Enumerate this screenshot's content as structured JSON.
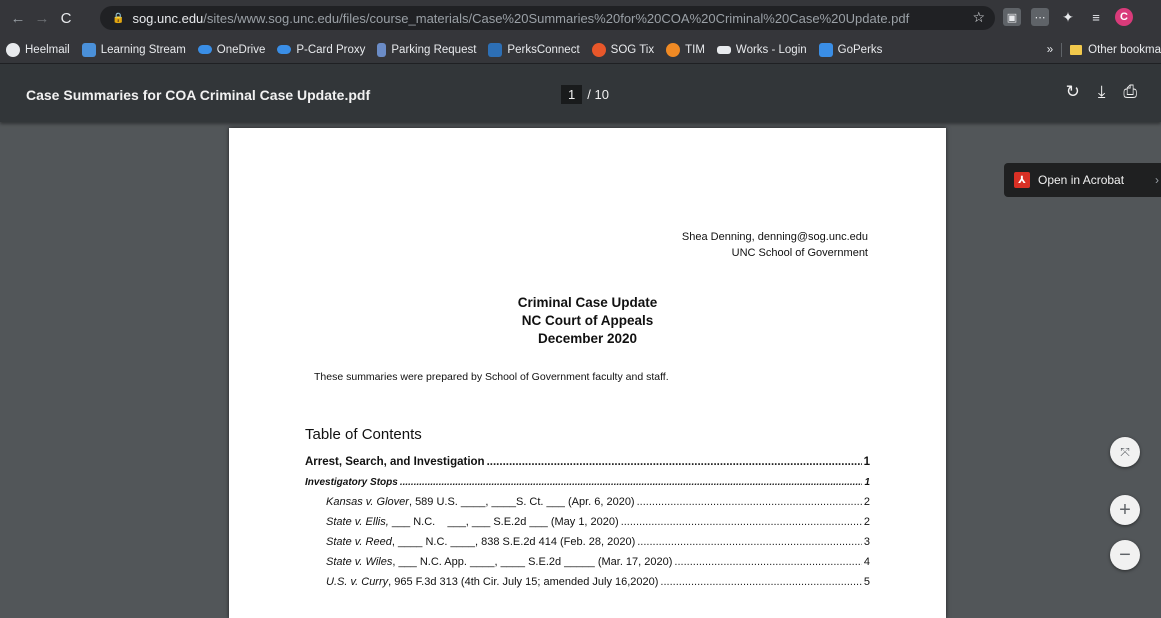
{
  "browser": {
    "url_host": "sog.unc.edu",
    "url_path": "/sites/www.sog.unc.edu/files/course_materials/Case%20Summaries%20for%20COA%20Criminal%20Case%20Update.pdf",
    "profile_initial": "C"
  },
  "bookmarks": {
    "items": [
      {
        "label": "Heelmail",
        "color": "#e8eaed"
      },
      {
        "label": "Learning Stream",
        "color": "#4a90d9"
      },
      {
        "label": "OneDrive",
        "color": "#3a8ee6"
      },
      {
        "label": "P-Card Proxy",
        "color": "#3a8ee6"
      },
      {
        "label": "Parking Request",
        "color": "#6b8cc7"
      },
      {
        "label": "PerksConnect",
        "color": "#2d6fb5"
      },
      {
        "label": "SOG Tix",
        "color": "#e8572a"
      },
      {
        "label": "TIM",
        "color": "#f08a24"
      },
      {
        "label": "Works - Login",
        "color": "#2d4f8a"
      },
      {
        "label": "GoPerks",
        "color": "#3a8ee6"
      }
    ],
    "overflow": "»",
    "other": "Other bookma"
  },
  "pdf_toolbar": {
    "title": "Case Summaries for COA Criminal Case Update.pdf",
    "current_page": "1",
    "total_pages": "/ 10"
  },
  "document": {
    "author_line1": "Shea Denning, denning@sog.unc.edu",
    "author_line2": "UNC School of Government",
    "heading1": "Criminal Case Update",
    "heading2": "NC Court of Appeals",
    "heading3": "December 2020",
    "prepared": "These summaries were prepared by School of Government faculty and staff.",
    "toc_title": "Table of Contents",
    "toc": [
      {
        "level": "l1",
        "case": "Arrest, Search, and Investigation",
        "rest": "",
        "page": "1"
      },
      {
        "level": "l2",
        "case": "Investigatory Stops",
        "rest": "",
        "page": "1"
      },
      {
        "level": "l3",
        "case": "Kansas v. Glover",
        "rest": ", 589 U.S. ____, ____S. Ct. ___ (Apr. 6, 2020)",
        "page": "2"
      },
      {
        "level": "l3",
        "case": "State v. Ellis,",
        "rest": " ___ N.C.    ___, ___ S.E.2d ___ (May 1, 2020)",
        "page": "2"
      },
      {
        "level": "l3",
        "case": "State v. Reed",
        "rest": ", ____ N.C. ____, 838 S.E.2d 414 (Feb. 28, 2020)",
        "page": "3"
      },
      {
        "level": "l3",
        "case": "State v. Wiles",
        "rest": " , ___ N.C. App. ____, ____ S.E.2d _____ (Mar. 17, 2020)",
        "page": "4"
      },
      {
        "level": "l3",
        "case": "U.S. v. Curry",
        "rest": ", 965 F.3d 313 (4th Cir. July 15; amended July 16,2020)",
        "page": "5"
      }
    ]
  },
  "acrobat_popup": {
    "label": "Open in Acrobat"
  }
}
